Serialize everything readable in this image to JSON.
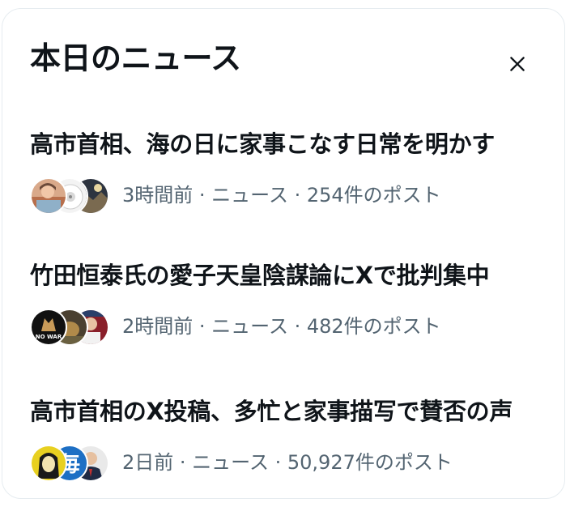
{
  "panel": {
    "title": "本日のニュース",
    "close_icon": "close-icon"
  },
  "colors": {
    "text_primary": "#0f1419",
    "text_secondary": "#536471",
    "border": "#e6ecf0"
  },
  "news": [
    {
      "headline": "高市首相、海の日に家事こなす日常を明かす",
      "time": "3時間前",
      "category": "ニュース",
      "posts": "254件のポスト",
      "avatars": [
        "person-photo-avatar",
        "cat-photo-avatar",
        "landscape-photo-avatar"
      ]
    },
    {
      "headline": "竹田恒泰氏の愛子天皇陰謀論にXで批判集中",
      "time": "2時間前",
      "category": "ニュース",
      "posts": "482件のポスト",
      "avatars": [
        "no-war-avatar",
        "dog-photo-avatar",
        "figure-photo-avatar"
      ],
      "avatar_badge_text": "NO WAR"
    },
    {
      "headline": "高市首相のX投稿、多忙と家事描写で賛否の声",
      "time": "2日前",
      "category": "ニュース",
      "posts": "50,927件のポスト",
      "avatars": [
        "yellow-cartoon-avatar",
        "mainichi-logo-avatar",
        "person-suit-avatar"
      ],
      "avatar_badge_text": "毎"
    }
  ],
  "separator": " · "
}
